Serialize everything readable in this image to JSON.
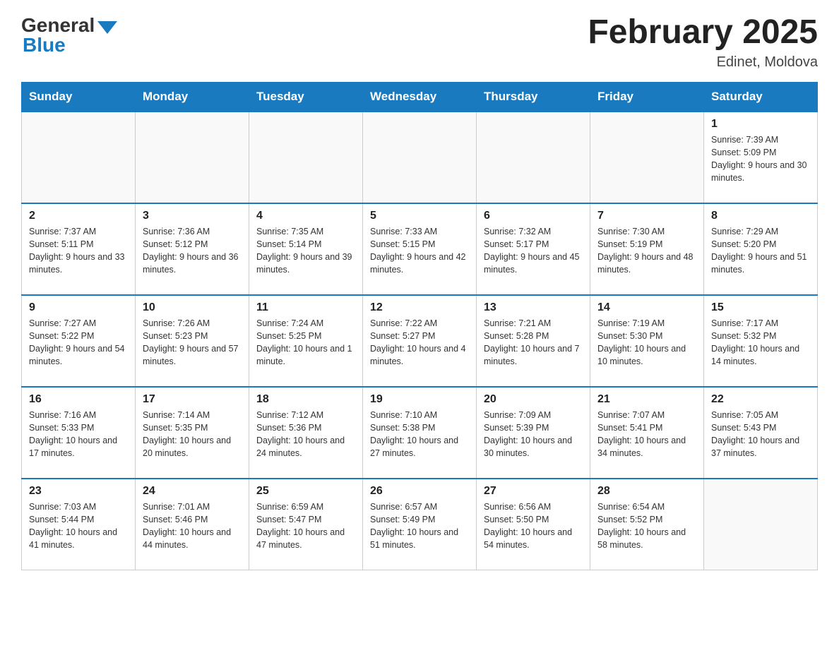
{
  "header": {
    "logo_general": "General",
    "logo_blue": "Blue",
    "month_title": "February 2025",
    "location": "Edinet, Moldova"
  },
  "days_of_week": [
    "Sunday",
    "Monday",
    "Tuesday",
    "Wednesday",
    "Thursday",
    "Friday",
    "Saturday"
  ],
  "weeks": [
    [
      {
        "day": "",
        "info": ""
      },
      {
        "day": "",
        "info": ""
      },
      {
        "day": "",
        "info": ""
      },
      {
        "day": "",
        "info": ""
      },
      {
        "day": "",
        "info": ""
      },
      {
        "day": "",
        "info": ""
      },
      {
        "day": "1",
        "info": "Sunrise: 7:39 AM\nSunset: 5:09 PM\nDaylight: 9 hours and 30 minutes."
      }
    ],
    [
      {
        "day": "2",
        "info": "Sunrise: 7:37 AM\nSunset: 5:11 PM\nDaylight: 9 hours and 33 minutes."
      },
      {
        "day": "3",
        "info": "Sunrise: 7:36 AM\nSunset: 5:12 PM\nDaylight: 9 hours and 36 minutes."
      },
      {
        "day": "4",
        "info": "Sunrise: 7:35 AM\nSunset: 5:14 PM\nDaylight: 9 hours and 39 minutes."
      },
      {
        "day": "5",
        "info": "Sunrise: 7:33 AM\nSunset: 5:15 PM\nDaylight: 9 hours and 42 minutes."
      },
      {
        "day": "6",
        "info": "Sunrise: 7:32 AM\nSunset: 5:17 PM\nDaylight: 9 hours and 45 minutes."
      },
      {
        "day": "7",
        "info": "Sunrise: 7:30 AM\nSunset: 5:19 PM\nDaylight: 9 hours and 48 minutes."
      },
      {
        "day": "8",
        "info": "Sunrise: 7:29 AM\nSunset: 5:20 PM\nDaylight: 9 hours and 51 minutes."
      }
    ],
    [
      {
        "day": "9",
        "info": "Sunrise: 7:27 AM\nSunset: 5:22 PM\nDaylight: 9 hours and 54 minutes."
      },
      {
        "day": "10",
        "info": "Sunrise: 7:26 AM\nSunset: 5:23 PM\nDaylight: 9 hours and 57 minutes."
      },
      {
        "day": "11",
        "info": "Sunrise: 7:24 AM\nSunset: 5:25 PM\nDaylight: 10 hours and 1 minute."
      },
      {
        "day": "12",
        "info": "Sunrise: 7:22 AM\nSunset: 5:27 PM\nDaylight: 10 hours and 4 minutes."
      },
      {
        "day": "13",
        "info": "Sunrise: 7:21 AM\nSunset: 5:28 PM\nDaylight: 10 hours and 7 minutes."
      },
      {
        "day": "14",
        "info": "Sunrise: 7:19 AM\nSunset: 5:30 PM\nDaylight: 10 hours and 10 minutes."
      },
      {
        "day": "15",
        "info": "Sunrise: 7:17 AM\nSunset: 5:32 PM\nDaylight: 10 hours and 14 minutes."
      }
    ],
    [
      {
        "day": "16",
        "info": "Sunrise: 7:16 AM\nSunset: 5:33 PM\nDaylight: 10 hours and 17 minutes."
      },
      {
        "day": "17",
        "info": "Sunrise: 7:14 AM\nSunset: 5:35 PM\nDaylight: 10 hours and 20 minutes."
      },
      {
        "day": "18",
        "info": "Sunrise: 7:12 AM\nSunset: 5:36 PM\nDaylight: 10 hours and 24 minutes."
      },
      {
        "day": "19",
        "info": "Sunrise: 7:10 AM\nSunset: 5:38 PM\nDaylight: 10 hours and 27 minutes."
      },
      {
        "day": "20",
        "info": "Sunrise: 7:09 AM\nSunset: 5:39 PM\nDaylight: 10 hours and 30 minutes."
      },
      {
        "day": "21",
        "info": "Sunrise: 7:07 AM\nSunset: 5:41 PM\nDaylight: 10 hours and 34 minutes."
      },
      {
        "day": "22",
        "info": "Sunrise: 7:05 AM\nSunset: 5:43 PM\nDaylight: 10 hours and 37 minutes."
      }
    ],
    [
      {
        "day": "23",
        "info": "Sunrise: 7:03 AM\nSunset: 5:44 PM\nDaylight: 10 hours and 41 minutes."
      },
      {
        "day": "24",
        "info": "Sunrise: 7:01 AM\nSunset: 5:46 PM\nDaylight: 10 hours and 44 minutes."
      },
      {
        "day": "25",
        "info": "Sunrise: 6:59 AM\nSunset: 5:47 PM\nDaylight: 10 hours and 47 minutes."
      },
      {
        "day": "26",
        "info": "Sunrise: 6:57 AM\nSunset: 5:49 PM\nDaylight: 10 hours and 51 minutes."
      },
      {
        "day": "27",
        "info": "Sunrise: 6:56 AM\nSunset: 5:50 PM\nDaylight: 10 hours and 54 minutes."
      },
      {
        "day": "28",
        "info": "Sunrise: 6:54 AM\nSunset: 5:52 PM\nDaylight: 10 hours and 58 minutes."
      },
      {
        "day": "",
        "info": ""
      }
    ]
  ]
}
